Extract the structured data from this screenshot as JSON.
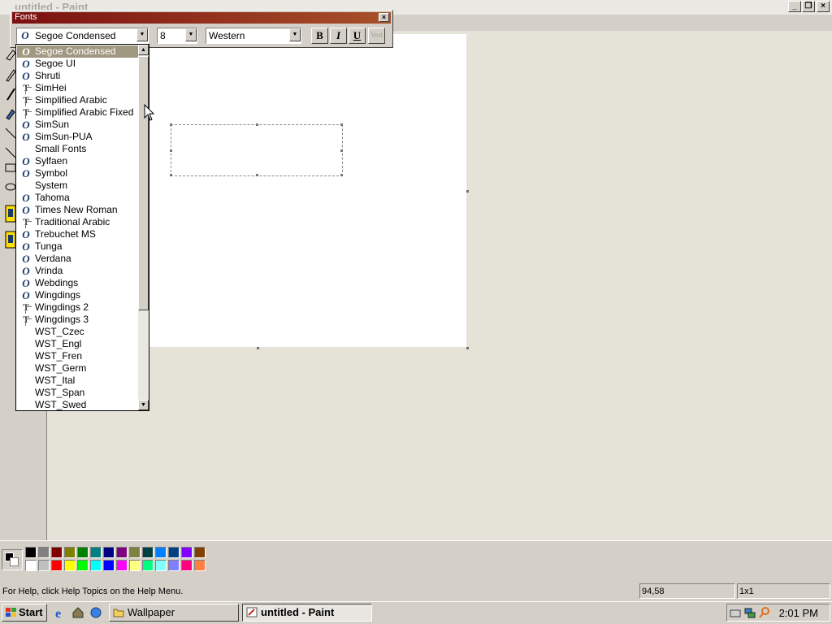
{
  "paint": {
    "title": "untitled - Paint",
    "status_help": "For Help, click Help Topics on the Help Menu.",
    "status_coords": "94,58",
    "status_size": "1x1"
  },
  "fonts_toolbar": {
    "title": "Fonts",
    "font_name": "Segoe Condensed",
    "font_size": "8",
    "script": "Western",
    "bold_label": "B",
    "italic_label": "I",
    "underline_label": "U",
    "vertical_label": "Vert"
  },
  "font_list": {
    "items": [
      {
        "name": "Segoe Condensed",
        "icon": "opentype-icon"
      },
      {
        "name": "Segoe UI",
        "icon": "opentype-icon"
      },
      {
        "name": "Shruti",
        "icon": "opentype-icon"
      },
      {
        "name": "SimHei",
        "icon": "truetype-icon"
      },
      {
        "name": "Simplified Arabic",
        "icon": "truetype-icon"
      },
      {
        "name": "Simplified Arabic Fixed",
        "icon": "truetype-icon"
      },
      {
        "name": "SimSun",
        "icon": "opentype-icon"
      },
      {
        "name": "SimSun-PUA",
        "icon": "opentype-icon"
      },
      {
        "name": "Small Fonts",
        "icon": ""
      },
      {
        "name": "Sylfaen",
        "icon": "opentype-icon"
      },
      {
        "name": "Symbol",
        "icon": "opentype-icon"
      },
      {
        "name": "System",
        "icon": ""
      },
      {
        "name": "Tahoma",
        "icon": "opentype-icon"
      },
      {
        "name": "Times New Roman",
        "icon": "opentype-icon"
      },
      {
        "name": "Traditional Arabic",
        "icon": "truetype-icon"
      },
      {
        "name": "Trebuchet MS",
        "icon": "opentype-icon"
      },
      {
        "name": "Tunga",
        "icon": "opentype-icon"
      },
      {
        "name": "Verdana",
        "icon": "opentype-icon"
      },
      {
        "name": "Vrinda",
        "icon": "opentype-icon"
      },
      {
        "name": "Webdings",
        "icon": "opentype-icon"
      },
      {
        "name": "Wingdings",
        "icon": "opentype-icon"
      },
      {
        "name": "Wingdings 2",
        "icon": "truetype-icon"
      },
      {
        "name": "Wingdings 3",
        "icon": "truetype-icon"
      },
      {
        "name": "WST_Czec",
        "icon": ""
      },
      {
        "name": "WST_Engl",
        "icon": ""
      },
      {
        "name": "WST_Fren",
        "icon": ""
      },
      {
        "name": "WST_Germ",
        "icon": ""
      },
      {
        "name": "WST_Ital",
        "icon": ""
      },
      {
        "name": "WST_Span",
        "icon": ""
      },
      {
        "name": "WST_Swed",
        "icon": ""
      }
    ],
    "selected_index": 0
  },
  "palette": {
    "colors_top": [
      "#000000",
      "#808080",
      "#800000",
      "#808000",
      "#008000",
      "#008080",
      "#000080",
      "#800080",
      "#808040",
      "#004040",
      "#0080ff",
      "#004080",
      "#8000ff",
      "#804000"
    ],
    "colors_bottom": [
      "#ffffff",
      "#c0c0c0",
      "#ff0000",
      "#ffff00",
      "#00ff00",
      "#00ffff",
      "#0000ff",
      "#ff00ff",
      "#ffff80",
      "#00ff80",
      "#80ffff",
      "#8080ff",
      "#ff0080",
      "#ff8040"
    ]
  },
  "taskbar": {
    "start_label": "Start",
    "buttons": [
      {
        "label": "Wallpaper",
        "icon": "folder-icon"
      },
      {
        "label": "untitled - Paint",
        "icon": "paint-icon"
      }
    ],
    "clock": "2:01 PM"
  }
}
